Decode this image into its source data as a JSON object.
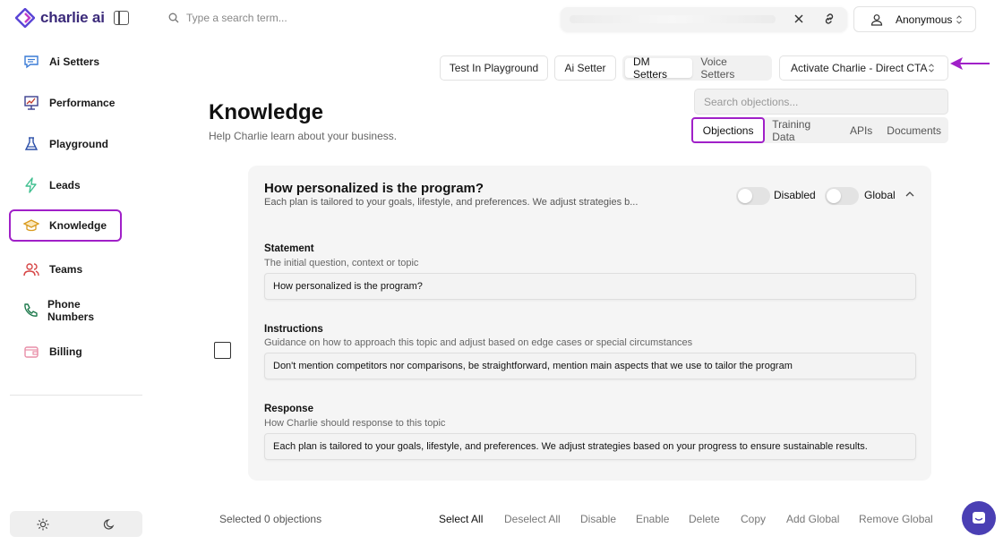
{
  "brand": {
    "name": "charlie ai",
    "color": "#3b2a7a"
  },
  "accent_highlight": "#a020c8",
  "sidebar": {
    "items": [
      {
        "label": "Ai Setters",
        "icon": "chat-bubble-icon"
      },
      {
        "label": "Performance",
        "icon": "presentation-chart-icon"
      },
      {
        "label": "Playground",
        "icon": "flask-icon"
      },
      {
        "label": "Leads",
        "icon": "lightning-icon"
      },
      {
        "label": "Knowledge",
        "icon": "graduation-cap-icon",
        "active": true
      },
      {
        "label": "Teams",
        "icon": "users-icon"
      },
      {
        "label": "Phone Numbers",
        "icon": "phone-icon"
      },
      {
        "label": "Billing",
        "icon": "wallet-icon"
      }
    ]
  },
  "topbar": {
    "search_placeholder": "Type a search term...",
    "user_label": "Anonymous"
  },
  "toolbar": {
    "test_playground": "Test In Playground",
    "ai_setter": "Ai Setter",
    "dm_setters": "DM Setters",
    "voice_setters": "Voice Setters",
    "cta_select": "Activate Charlie - Direct CTA"
  },
  "header": {
    "title": "Knowledge",
    "subtitle": "Help Charlie learn about your business.",
    "objection_search_placeholder": "Search objections...",
    "tabs": [
      "Objections",
      "Training Data",
      "APIs",
      "Documents"
    ]
  },
  "card": {
    "title": "How personalized is the program?",
    "description": "Each plan is tailored to your goals, lifestyle, and preferences. We adjust strategies b...",
    "disabled_label": "Disabled",
    "global_label": "Global",
    "statement": {
      "label": "Statement",
      "hint": "The initial question, context or topic",
      "value": "How personalized is the program?"
    },
    "instructions": {
      "label": "Instructions",
      "hint": "Guidance on how to approach this topic and adjust based on edge cases or special circumstances",
      "value": "Don't mention competitors nor comparisons, be straightforward, mention main aspects that we use to tailor the program"
    },
    "response": {
      "label": "Response",
      "hint": "How Charlie should response to this topic",
      "value": "Each plan is tailored to your goals, lifestyle, and preferences. We adjust strategies based on your progress to ensure sustainable results."
    }
  },
  "footer": {
    "selected_count": "Selected 0 objections",
    "select_all": "Select All",
    "deselect_all": "Deselect All",
    "disable": "Disable",
    "enable": "Enable",
    "delete": "Delete",
    "copy": "Copy",
    "add_global": "Add Global",
    "remove_global": "Remove Global"
  }
}
